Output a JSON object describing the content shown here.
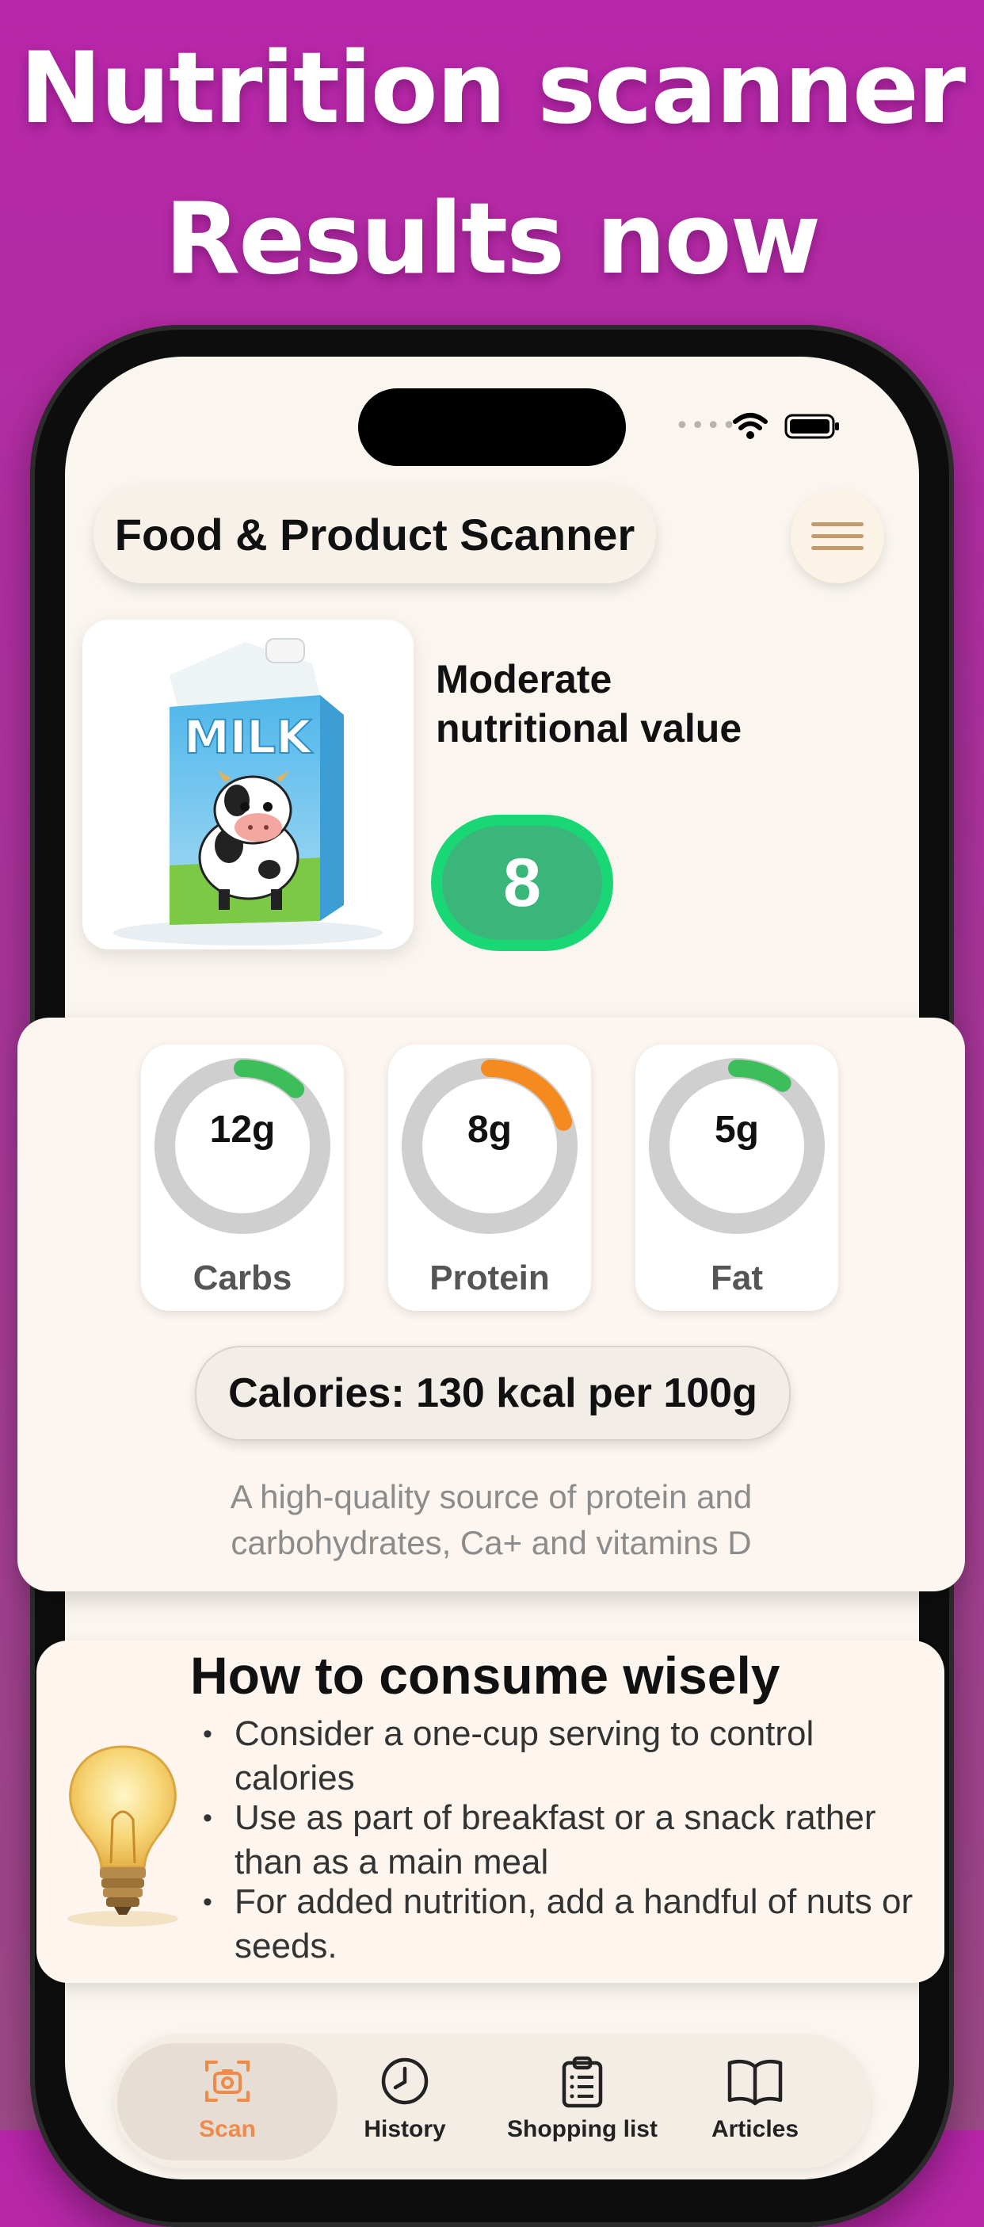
{
  "headline": {
    "line1": "Nutrition scanner",
    "line2": "Results now"
  },
  "status_bar": {
    "signal": "••••"
  },
  "header": {
    "title": "Food & Product Scanner",
    "menu_icon": "hamburger-icon"
  },
  "product": {
    "image_label": "MILK",
    "verdict": "Moderate nutritional value",
    "score": "8",
    "score_color": "#3bb67a"
  },
  "macros": [
    {
      "value": "12g",
      "label": "Carbs",
      "fraction": 0.12,
      "color": "#3cbf5a"
    },
    {
      "value": "8g",
      "label": "Protein",
      "fraction": 0.2,
      "color": "#f58a1f"
    },
    {
      "value": "5g",
      "label": "Fat",
      "fraction": 0.1,
      "color": "#3cbf5a"
    }
  ],
  "calories": "Calories: 130 kcal per 100g",
  "description": {
    "line1": "A high-quality source of protein and",
    "line2": "carbohydrates, Ca+ and vitamins D"
  },
  "tips": {
    "title": "How to consume wisely",
    "items": [
      "Consider a one-cup serving to control calories",
      "Use as part of breakfast or a snack rather than as a main meal",
      "For added nutrition, add a handful of nuts or seeds."
    ]
  },
  "tabs": [
    {
      "label": "Scan",
      "icon": "camera-icon",
      "active": true
    },
    {
      "label": "History",
      "icon": "clock-icon",
      "active": false
    },
    {
      "label": "Shopping list",
      "icon": "clipboard-icon",
      "active": false
    },
    {
      "label": "Articles",
      "icon": "book-icon",
      "active": false
    }
  ],
  "colors": {
    "background": "#b826a9",
    "accent_orange": "#f08a4b",
    "score_green": "#19d775"
  }
}
